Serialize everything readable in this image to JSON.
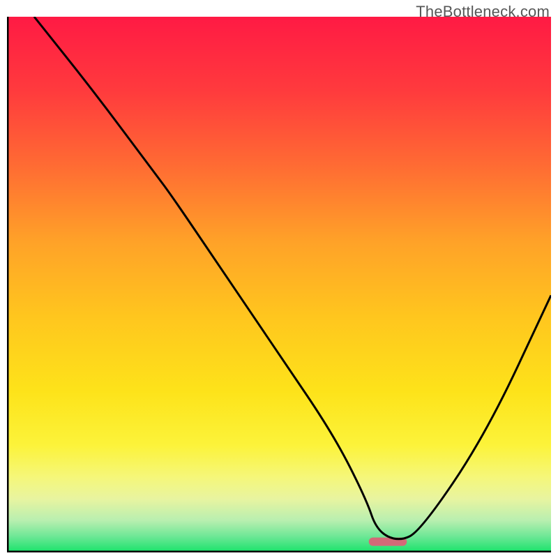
{
  "watermark": "TheBottleneck.com",
  "chart_data": {
    "type": "line",
    "title": "",
    "xlabel": "",
    "ylabel": "",
    "xlim": [
      0,
      100
    ],
    "ylim": [
      0,
      100
    ],
    "grid": false,
    "legend": false,
    "gradient_stops": [
      {
        "offset": 0.0,
        "color": "#ff1a44"
      },
      {
        "offset": 0.14,
        "color": "#ff3b3d"
      },
      {
        "offset": 0.28,
        "color": "#ff6c33"
      },
      {
        "offset": 0.42,
        "color": "#ffa228"
      },
      {
        "offset": 0.56,
        "color": "#ffc61e"
      },
      {
        "offset": 0.7,
        "color": "#fde31a"
      },
      {
        "offset": 0.8,
        "color": "#fcf33a"
      },
      {
        "offset": 0.86,
        "color": "#f5f77a"
      },
      {
        "offset": 0.9,
        "color": "#e8f4a0"
      },
      {
        "offset": 0.94,
        "color": "#b9efb0"
      },
      {
        "offset": 0.97,
        "color": "#6ee796"
      },
      {
        "offset": 1.0,
        "color": "#17e36a"
      }
    ],
    "series": [
      {
        "name": "bottleneck-curve",
        "x": [
          5,
          16,
          27,
          30,
          40,
          50,
          60,
          66,
          68,
          72,
          76,
          88,
          100
        ],
        "y": [
          100,
          86,
          71,
          67,
          52,
          37,
          22,
          10,
          4,
          2,
          4,
          22,
          48
        ]
      }
    ],
    "marker": {
      "x_center": 70,
      "x_width": 7,
      "y": 2,
      "color": "#d46a78"
    }
  },
  "colors": {
    "axis": "#000000",
    "curve": "#000000",
    "watermark": "#575757",
    "background": "#ffffff"
  }
}
